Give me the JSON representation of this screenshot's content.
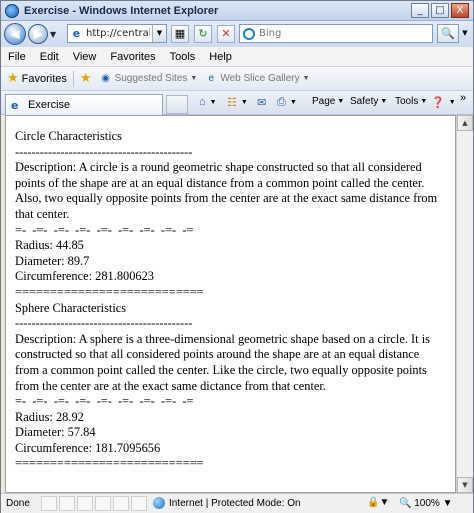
{
  "window": {
    "title": "Exercise - Windows Internet Explorer",
    "minimize": "_",
    "restore": "□",
    "close": "X"
  },
  "address": {
    "url": "http://central/ex",
    "search_placeholder": "Bing",
    "search_icon": "magnifier-icon"
  },
  "menu": [
    "File",
    "Edit",
    "View",
    "Favorites",
    "Tools",
    "Help"
  ],
  "favorites": {
    "label": "Favorites",
    "links": [
      "Suggested Sites",
      "Web Slice Gallery"
    ]
  },
  "tab": {
    "label": "Exercise"
  },
  "commands": {
    "page": "Page",
    "safety": "Safety",
    "tools": "Tools",
    "more": "»"
  },
  "document": {
    "circle": {
      "heading": "Circle Characteristics",
      "rule_dash": "-------------------------------------------",
      "description": "Description: A circle is a round geometric shape constructed so that all considered points of the shape are at an equal distance from a common point called the center. Also, two equally opposite points from the center are at the exact same distance from that center.",
      "rule_mixed": "=-  -=-  -=-  -=-  -=-  -=-  -=-  -=-  -=",
      "radius": "Radius: 44.85",
      "diameter": "Diameter: 89.7",
      "circumference": "Circumference: 281.800623",
      "rule_equals": "==========================="
    },
    "sphere": {
      "heading": "Sphere Characteristics",
      "rule_dash": "-------------------------------------------",
      "description": "Description: A sphere is a three-dimensional geometric shape based on a circle. It is constructed so that all considered points around the shape are at an equal distance from a common point called the center. Like the circle, two equally opposite points from the center are at the exact same dictance from that center.",
      "rule_mixed": "=-  -=-  -=-  -=-  -=-  -=-  -=-  -=-  -=",
      "radius": "Radius: 28.92",
      "diameter": "Diameter: 57.84",
      "circumference": "Circumference: 181.7095656",
      "rule_equals": "==========================="
    }
  },
  "status": {
    "done": "Done",
    "zone": "Internet | Protected Mode: On",
    "zoom": "100%"
  }
}
